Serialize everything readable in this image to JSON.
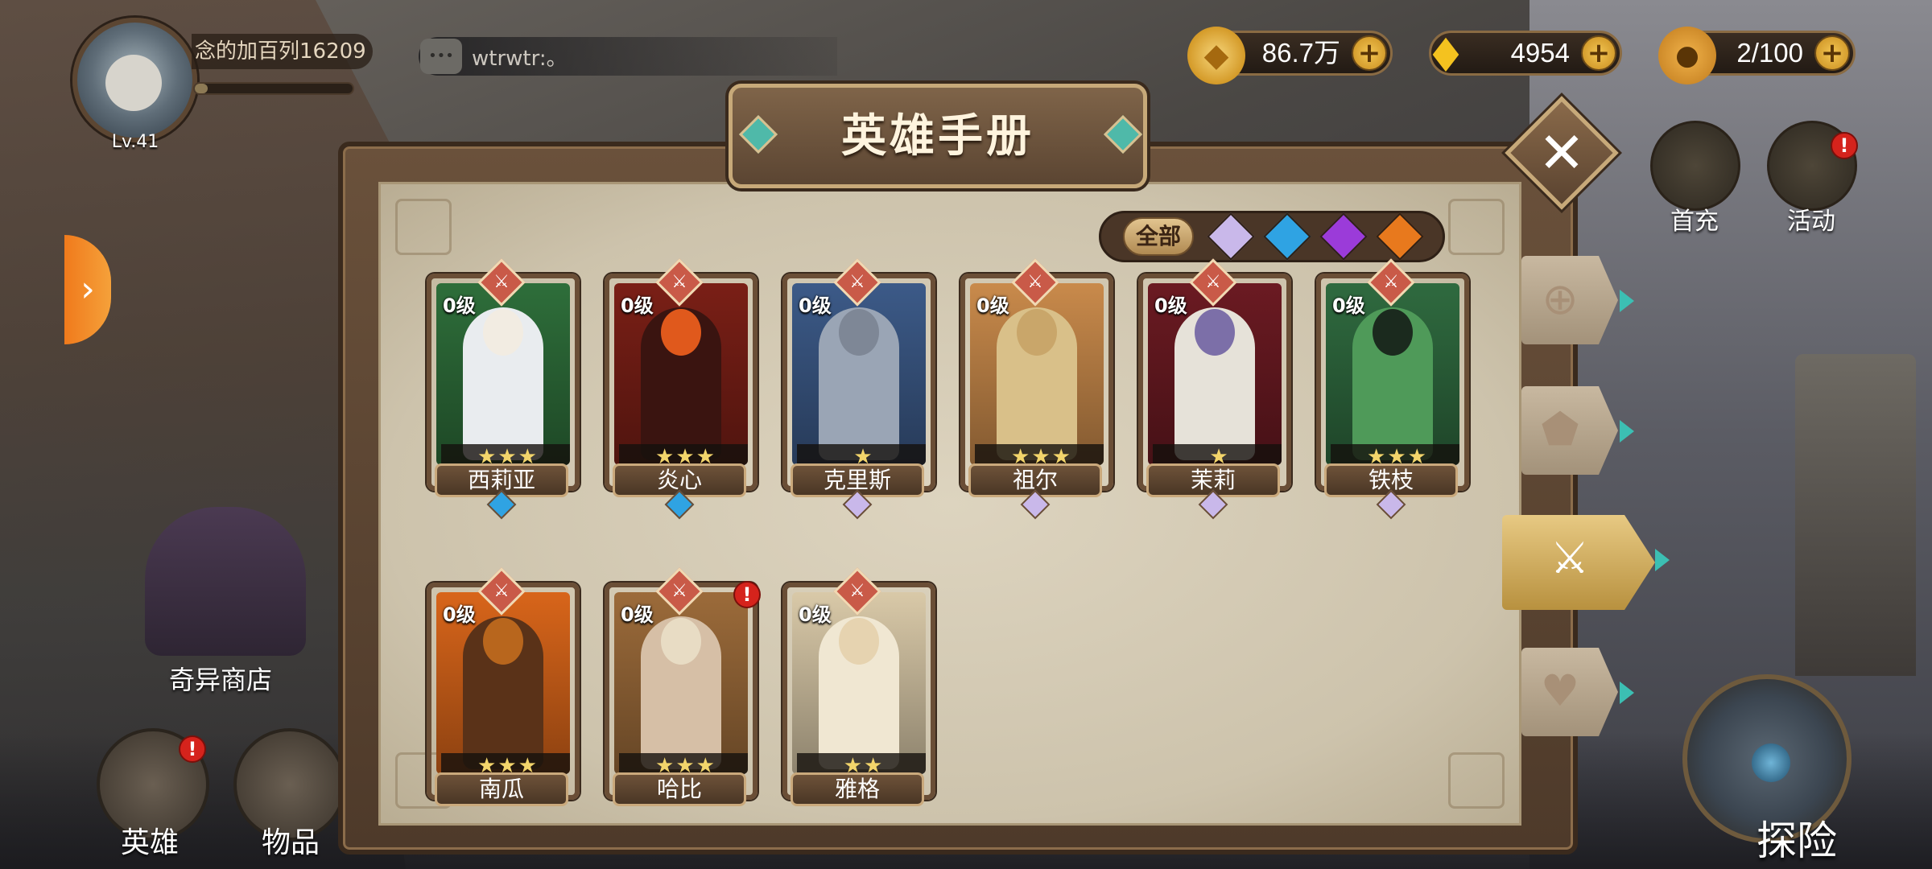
{
  "player": {
    "level": "Lv.41",
    "name": "念的加百列16209",
    "exp_fraction": 0.08
  },
  "chat": {
    "text": "wtrwtr:。"
  },
  "resources": [
    {
      "icon": "gold-coin-icon",
      "value": "86.7万"
    },
    {
      "icon": "diamond-icon",
      "value": "4954"
    },
    {
      "icon": "stamina-food-icon",
      "value": "2/100"
    }
  ],
  "top_right_buttons": [
    {
      "label": "首充",
      "icon": "first-recharge-icon",
      "alert": false
    },
    {
      "label": "活动",
      "icon": "event-icon",
      "alert": true,
      "alert_text": "!"
    }
  ],
  "left_tab_arrow": "›",
  "shop": {
    "label": "奇异商店"
  },
  "bottom_nav": [
    {
      "label": "英雄",
      "icon": "hero-helmet-icon",
      "alert": true,
      "alert_text": "!"
    },
    {
      "label": "物品",
      "icon": "item-bag-icon",
      "alert": false
    }
  ],
  "explore": {
    "label": "探险"
  },
  "panel": {
    "title": "英雄手册",
    "close_glyph": "✕",
    "filter": {
      "all_label": "全部",
      "selected": "全部",
      "rarity_colors": [
        "#c9b8ea",
        "#2fa3e3",
        "#9b3bd9",
        "#e8791d"
      ]
    },
    "heroes": [
      {
        "name": "西莉亚",
        "level": "0级",
        "stars": "★★★",
        "rarity_color": "#2fa3e3",
        "bg": "#2e6e3a",
        "figure": "#e9ecef",
        "head": "#f2ece2",
        "alert": false
      },
      {
        "name": "炎心",
        "level": "0级",
        "stars": "★★★",
        "rarity_color": "#2fa3e3",
        "bg": "#7a1f16",
        "figure": "#3a1410",
        "head": "#e0591c",
        "alert": false
      },
      {
        "name": "克里斯",
        "level": "0级",
        "stars": "★",
        "rarity_color": "#c9b8ea",
        "bg": "#3c5a88",
        "figure": "#9aa5b5",
        "head": "#7e8796",
        "alert": false
      },
      {
        "name": "祖尔",
        "level": "0级",
        "stars": "★★★",
        "rarity_color": "#c9b8ea",
        "bg": "#c98a4b",
        "figure": "#d9c089",
        "head": "#c9a66a",
        "alert": false
      },
      {
        "name": "茉莉",
        "level": "0级",
        "stars": "★",
        "rarity_color": "#c9b8ea",
        "bg": "#6b1a22",
        "figure": "#e6e2d9",
        "head": "#7c6fa8",
        "alert": false
      },
      {
        "name": "铁枝",
        "level": "0级",
        "stars": "★★★",
        "rarity_color": "#c9b8ea",
        "bg": "#2f6a3f",
        "figure": "#4f9a59",
        "head": "#1b2a1e",
        "alert": false
      },
      {
        "name": "南瓜",
        "level": "0级",
        "stars": "★★★",
        "rarity_color": "",
        "bg": "#d8651a",
        "figure": "#5a3218",
        "head": "#b8661d",
        "alert": false
      },
      {
        "name": "哈比",
        "level": "0级",
        "stars": "★★★",
        "rarity_color": "",
        "bg": "#9c6b3a",
        "figure": "#d6bfa6",
        "head": "#e8dcc4",
        "alert": true,
        "alert_text": "!"
      },
      {
        "name": "雅格",
        "level": "0级",
        "stars": "★★",
        "rarity_color": "",
        "bg": "#d9c9a8",
        "figure": "#f0e7d2",
        "head": "#e6d3b0",
        "alert": false
      }
    ],
    "side_tabs": [
      {
        "icon": "grid-icon",
        "glyph": "⊕",
        "active": false
      },
      {
        "icon": "shield-icon",
        "glyph": "⬟",
        "active": false
      },
      {
        "icon": "sword-icon",
        "glyph": "⚔",
        "active": true
      },
      {
        "icon": "heart-icon",
        "glyph": "♥",
        "active": false
      }
    ]
  }
}
